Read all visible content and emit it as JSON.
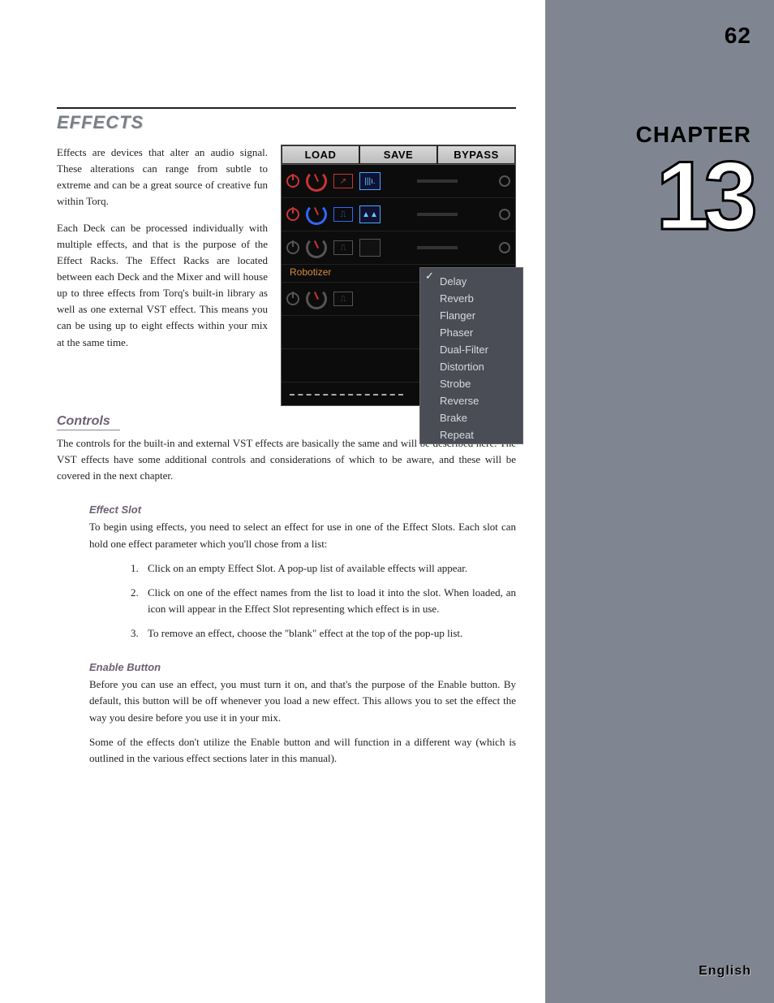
{
  "page_number": "62",
  "chapter_label": "CHAPTER",
  "chapter_number": "13",
  "language": "English",
  "title": "EFFECTS",
  "intro_p1": "Effects are devices that alter an audio signal. These alterations can range from subtle to extreme and can be a great source of creative fun within Torq.",
  "intro_p2": "Each Deck can be processed individually with multiple effects, and that is the purpose of the Effect Racks. The Effect Racks are located between each Deck and the Mixer and will house up to three effects from Torq's built-in library as well as one external VST effect. This means you can be using up to eight effects within your mix at the same time.",
  "figure": {
    "buttons": {
      "load": "LOAD",
      "save": "SAVE",
      "bypass": "BYPASS"
    },
    "slot_label": "Robotizer",
    "dropdown": [
      "Delay",
      "Reverb",
      "Flanger",
      "Phaser",
      "Dual-Filter",
      "Distortion",
      "Strobe",
      "Reverse",
      "Brake",
      "Repeat"
    ]
  },
  "controls_heading": "Controls",
  "controls_p": "The controls for the built-in and external VST effects are basically the same and will be described here. The VST effects have some additional controls and considerations of which to be aware, and these will be covered in the next chapter.",
  "effect_slot_heading": "Effect Slot",
  "effect_slot_p": "To begin using effects, you need to select an effect for use in one of the Effect Slots. Each slot can hold one effect parameter which you'll chose from a list:",
  "steps": [
    "Click on an empty Effect Slot. A pop-up list of available effects will appear.",
    "Click on one of the effect names from the list to load it into the slot. When loaded, an icon will appear in the Effect Slot representing which effect is in use.",
    "To remove an effect, choose the \"blank\" effect at the top of the pop-up list."
  ],
  "enable_heading": "Enable Button",
  "enable_p1": "Before you can use an effect, you must turn it on, and that's the purpose of the Enable button. By default, this button will be off whenever you load a new effect. This allows you to set the effect the way you desire before you use it in your mix.",
  "enable_p2": "Some of the effects don't utilize the Enable button and will function in a different way (which is outlined in the various effect sections later in this manual)."
}
